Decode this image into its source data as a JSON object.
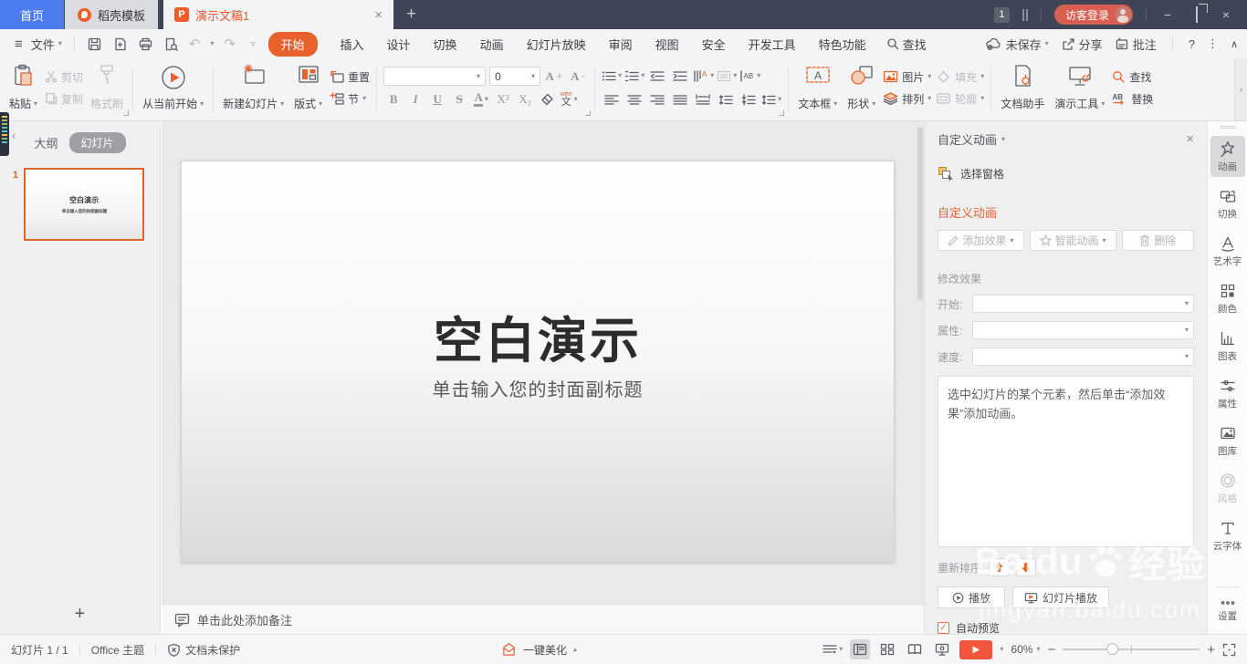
{
  "titlebar": {
    "home_tab": "首页",
    "docer_tab": "稻壳模板",
    "doc_tab": "演示文稿1",
    "window_badge": "1",
    "login_button": "访客登录"
  },
  "menubar": {
    "file": "文件",
    "home_active": "开始",
    "items": [
      "插入",
      "设计",
      "切换",
      "动画",
      "幻灯片放映",
      "审阅",
      "视图",
      "安全",
      "开发工具",
      "特色功能"
    ],
    "find": "查找",
    "save_status": "未保存",
    "share": "分享",
    "comment": "批注",
    "help": "?"
  },
  "ribbon": {
    "paste": "粘贴",
    "cut": "剪切",
    "copy": "复制",
    "format_painter": "格式刷",
    "from_current": "从当前开始",
    "new_slide": "新建幻灯片",
    "layout": "版式",
    "reset": "重置",
    "section": "节",
    "font_size_value": "0",
    "bold": "B",
    "italic": "I",
    "underline": "U",
    "strike": "S",
    "font_color": "A",
    "superscript": "X²",
    "subscript": "X₂",
    "pinyin_mark": "wén",
    "pinyin_char": "文",
    "textbox": "文本框",
    "shapes": "形状",
    "picture": "图片",
    "fill": "填充",
    "arrange": "排列",
    "outline": "轮廓",
    "doc_assistant": "文档助手",
    "present_tools": "演示工具",
    "find": "查找",
    "replace": "替换"
  },
  "left_panel": {
    "outline_tab": "大纲",
    "slides_tab": "幻灯片",
    "slide_number": "1",
    "thumb_title": "空白演示",
    "thumb_subtitle": "单击输入您的封面副标题",
    "add_slide": "+"
  },
  "slide": {
    "title": "空白演示",
    "subtitle": "单击输入您的封面副标题"
  },
  "notes_bar": {
    "placeholder": "单击此处添加备注"
  },
  "animation_pane": {
    "title": "自定义动画",
    "select_pane": "选择窗格",
    "group_title": "自定义动画",
    "add_effect": "添加效果",
    "smart_animation": "智能动画",
    "delete_button": "删除",
    "modify_section": "修改效果",
    "start_label": "开始:",
    "property_label": "属性:",
    "speed_label": "速度:",
    "hint": "选中幻灯片的某个元素，然后单击“添加效果”添加动画。",
    "reorder_label": "重新排序",
    "play_button": "播放",
    "slideshow_button": "幻灯片播放",
    "auto_preview": "自动预览"
  },
  "right_sidebar": {
    "items": [
      "动画",
      "切换",
      "艺术字",
      "颜色",
      "图表",
      "属性",
      "图库",
      "风格",
      "云字体",
      "设置"
    ]
  },
  "statusbar": {
    "slide_indicator": "幻灯片 1 / 1",
    "theme": "Office 主题",
    "protection": "文档未保护",
    "beautify": "一键美化",
    "zoom_level": "60%"
  },
  "watermark": {
    "brand": "Baidu",
    "suffix": "经验",
    "url": "jingyan.baidu.com"
  },
  "icons": {
    "chevron_down": "▾",
    "chevron_tiny": "▿",
    "chevron_up": "∧",
    "close": "×",
    "minimize": "−",
    "undo": "↶",
    "redo": "↷",
    "hamburger": "≡",
    "more_v": "⋮",
    "back": "‹",
    "expand": "›",
    "check": "✓",
    "play": "▶"
  },
  "colors": {
    "accent_orange": "#e8612c",
    "tab_blue": "#4d7bf0",
    "login_red": "#d85f51",
    "statusbar_play": "#f2553c",
    "titlebar_bg": "#3f4456"
  }
}
